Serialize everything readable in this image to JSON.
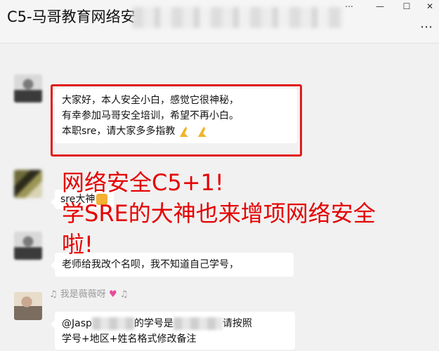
{
  "window": {
    "title": "C5-马哥教育网络安",
    "controls": [
      "⋯",
      "—",
      "☐",
      "✕"
    ],
    "more": "⋯"
  },
  "messages": [
    {
      "lines": [
        "大家好，本人安全小白，感觉它很神秘，",
        "有幸参加马哥安全培训，希望不再小白。",
        "本职sre，请大家多多指教"
      ],
      "emoji": "pray-icon"
    },
    {
      "text": "sre大神",
      "emoji": "thumbs-up-icon"
    },
    {
      "text": "老师给我改个名呗，我不知道自己学号，"
    },
    {
      "sender": "我是薇薇呀",
      "lines": [
        "@Jasp",
        "的学号是",
        "请按照",
        "学号+地区+姓名格式修改备注"
      ]
    }
  ],
  "overlay": {
    "lines": [
      "网络安全C5+1!",
      "学SRE的大神也来增项网络安全",
      "啦!"
    ],
    "color": "#e60000"
  },
  "colors": {
    "highlight_border": "#e21b1b",
    "background": "#f1f1f1"
  }
}
